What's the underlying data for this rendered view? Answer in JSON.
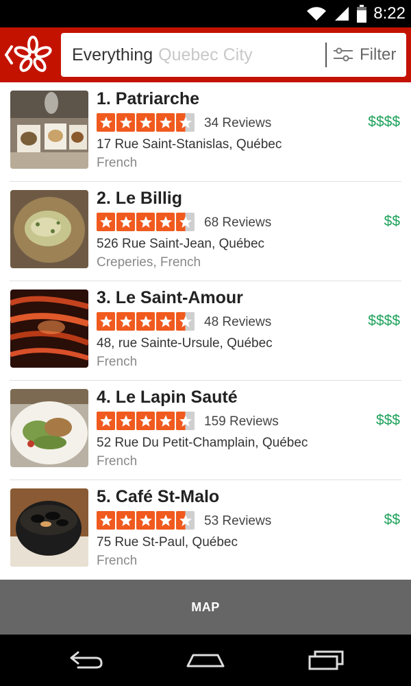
{
  "status_bar": {
    "time": "8:22",
    "icons": [
      "wifi-icon",
      "signal-icon",
      "battery-icon"
    ]
  },
  "search": {
    "query": "Everything",
    "location_placeholder": "Quebec City",
    "filter_label": "Filter"
  },
  "colors": {
    "brand_red": "#c41200",
    "star_orange": "#f05a1e",
    "price_green": "#1da15b"
  },
  "results": [
    {
      "title": "1. Patriarche",
      "rating": 4.5,
      "reviews": "34 Reviews",
      "price": "$$$$",
      "address": "17 Rue Saint-Stanislas, Québec",
      "category": "French"
    },
    {
      "title": "2. Le Billig",
      "rating": 4.5,
      "reviews": "68 Reviews",
      "price": "$$",
      "address": "526 Rue Saint-Jean, Québec",
      "category": "Creperies, French"
    },
    {
      "title": "3. Le Saint-Amour",
      "rating": 4.5,
      "reviews": "48 Reviews",
      "price": "$$$$",
      "address": "48, rue Sainte-Ursule, Québec",
      "category": "French"
    },
    {
      "title": "4. Le Lapin Sauté",
      "rating": 4.5,
      "reviews": "159 Reviews",
      "price": "$$$",
      "address": "52 Rue Du Petit-Champlain, Québec",
      "category": "French"
    },
    {
      "title": "5. Café St-Malo",
      "rating": 4.5,
      "reviews": "53 Reviews",
      "price": "$$",
      "address": "75 Rue St-Paul, Québec",
      "category": "French"
    }
  ],
  "map_bar": {
    "label": "MAP"
  },
  "nav_bar": {
    "buttons": [
      "back-icon",
      "home-icon",
      "recent-apps-icon"
    ]
  }
}
